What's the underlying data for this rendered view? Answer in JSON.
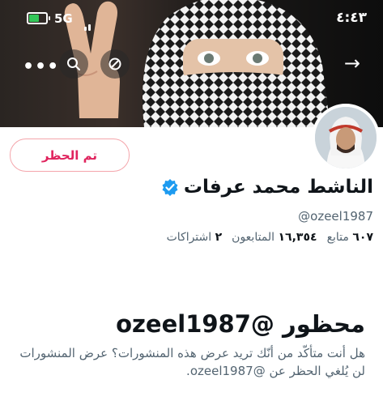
{
  "status_bar": {
    "time": "٤:٤٣",
    "network": "5G"
  },
  "header": {
    "more_icon": "more-dots-icon",
    "search_icon": "search-icon",
    "blocked_icon": "blocked-circle-icon",
    "back_icon": "arrow-right-icon"
  },
  "profile": {
    "name": "الناشط محمد عرفات",
    "handle": "@ozeel1987",
    "verified": true,
    "following_count": "٦٠٧",
    "following_label": "متابع",
    "followers_count": "١٦,٣٥٤",
    "followers_label": "المتابعون",
    "subscriptions_count": "٢",
    "subscriptions_label": "اشتراكات"
  },
  "actions": {
    "block_button_label": "تم الحظر"
  },
  "blocked_notice": {
    "title": "محظور @ozeel1987",
    "message": "هل أنت متأكّد من أنّك تريد عرض هذه المنشورات؟ عرض المنشورات لن يُلغي الحظر عن @ozeel1987."
  },
  "colors": {
    "block_red": "#e0245e",
    "verified_blue": "#1d9bf0",
    "muted_text": "#536471"
  }
}
